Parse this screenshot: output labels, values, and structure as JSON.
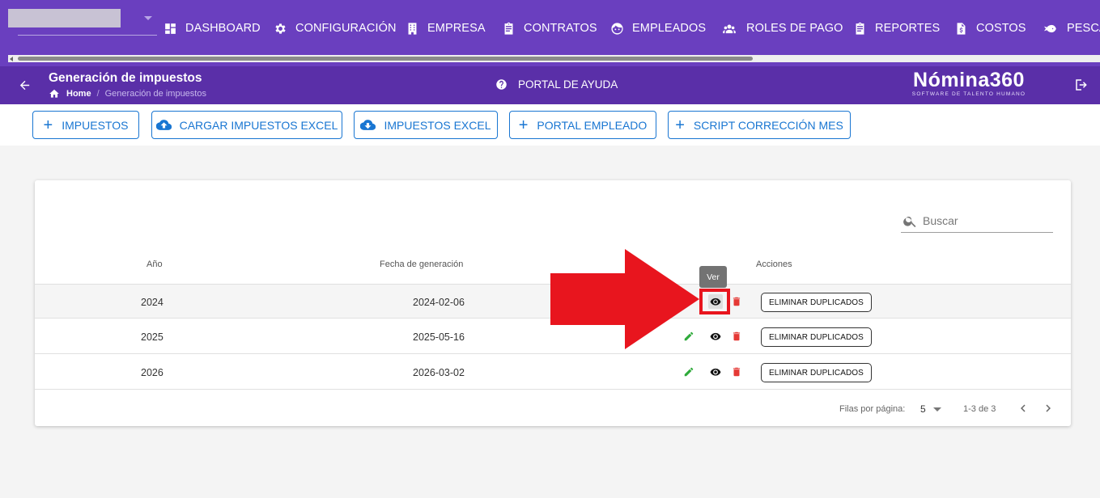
{
  "nav": {
    "items": [
      {
        "label": "DASHBOARD",
        "icon": "dashboard-icon"
      },
      {
        "label": "CONFIGURACIÓN",
        "icon": "gear-icon"
      },
      {
        "label": "EMPRESA",
        "icon": "building-icon"
      },
      {
        "label": "CONTRATOS",
        "icon": "clipboard-icon"
      },
      {
        "label": "EMPLEADOS",
        "icon": "face-icon"
      },
      {
        "label": "ROLES DE PAGO",
        "icon": "group-icon"
      },
      {
        "label": "REPORTES",
        "icon": "clipboard-icon"
      },
      {
        "label": "COSTOS",
        "icon": "invoice-icon"
      },
      {
        "label": "PESCA",
        "icon": "fish-icon"
      }
    ]
  },
  "header": {
    "title": "Generación de impuestos",
    "breadcrumb_home": "Home",
    "breadcrumb_current": "Generación de impuestos",
    "help_label": "PORTAL DE AYUDA",
    "brand_name": "Nómina360",
    "brand_tagline": "SOFTWARE DE TALENTO HUMANO"
  },
  "toolbar": {
    "impuestos": "IMPUESTOS",
    "cargar_excel": "CARGAR IMPUESTOS EXCEL",
    "impuestos_excel": "IMPUESTOS EXCEL",
    "portal_empleado": "PORTAL EMPLEADO",
    "script_correccion": "SCRIPT CORRECCIÓN MES"
  },
  "table": {
    "search_placeholder": "Buscar",
    "headers": {
      "year": "Año",
      "date": "Fecha de generación",
      "actions": "Acciones"
    },
    "rows": [
      {
        "year": "2024",
        "date": "2024-02-06",
        "action": "ELIMINAR DUPLICADOS"
      },
      {
        "year": "2025",
        "date": "2025-05-16",
        "action": "ELIMINAR DUPLICADOS"
      },
      {
        "year": "2026",
        "date": "2026-03-02",
        "action": "ELIMINAR DUPLICADOS"
      }
    ],
    "rows_per_page_label": "Filas por página:",
    "rows_per_page": "5",
    "range": "1-3 de 3"
  },
  "tooltip": "Ver",
  "colors": {
    "nav_bg": "#6a3fbf",
    "title_bg": "#5a2fa8",
    "primary": "#1976d2",
    "edit": "#2eaa3a",
    "delete": "#e53935",
    "annotation": "#e8151e"
  }
}
